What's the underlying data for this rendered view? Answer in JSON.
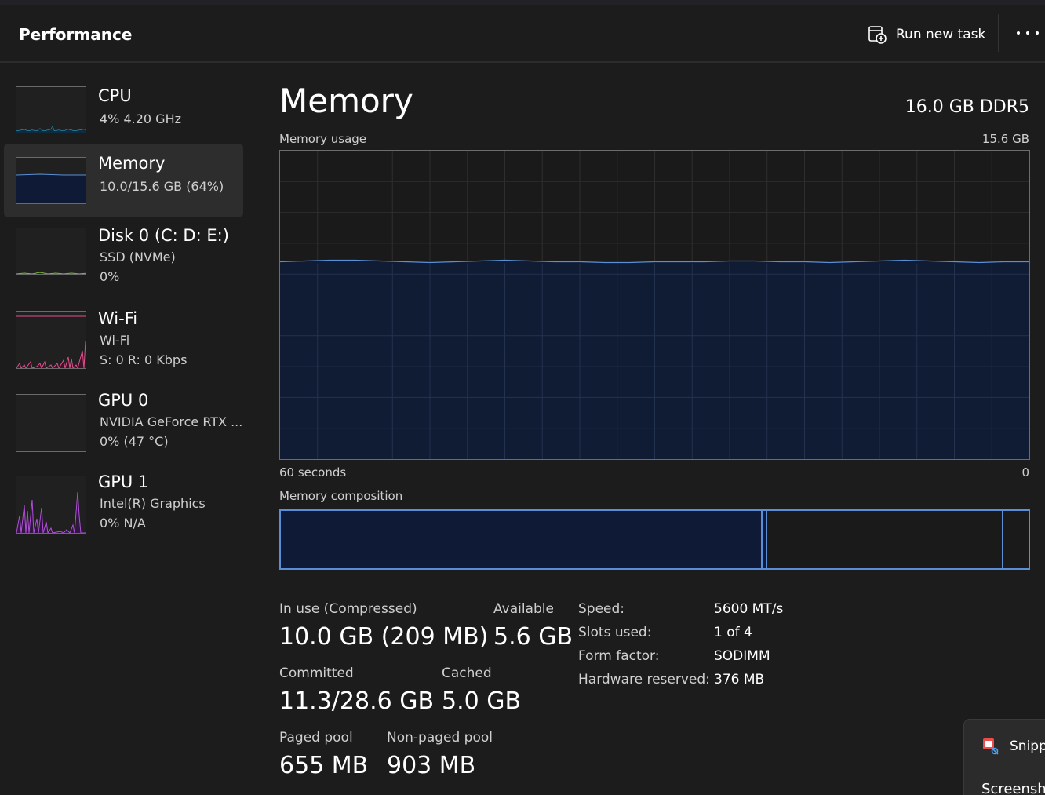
{
  "header": {
    "title": "Performance",
    "run_task_label": "Run new task",
    "more_icon": "more-options-icon"
  },
  "sidebar": {
    "items": [
      {
        "name": "CPU",
        "sub1": "4%  4.20 GHz",
        "sub2": "",
        "color": "#3ab4e8",
        "selected": false
      },
      {
        "name": "Memory",
        "sub1": "10.0/15.6 GB (64%)",
        "sub2": "",
        "color": "#5a8fd8",
        "selected": true
      },
      {
        "name": "Disk 0 (C: D: E:)",
        "sub1": "SSD (NVMe)",
        "sub2": "0%",
        "color": "#7fbf3f",
        "selected": false
      },
      {
        "name": "Wi-Fi",
        "sub1": "Wi-Fi",
        "sub2": "S: 0  R: 0 Kbps",
        "color": "#e0508c",
        "selected": false
      },
      {
        "name": "GPU 0",
        "sub1": "NVIDIA GeForce RTX ...",
        "sub2": "0%  (47 °C)",
        "color": "#b050d8",
        "selected": false
      },
      {
        "name": "GPU 1",
        "sub1": "Intel(R) Graphics",
        "sub2": "0%  N/A",
        "color": "#b050d8",
        "selected": false
      }
    ]
  },
  "memory": {
    "title": "Memory",
    "total_type": "16.0 GB DDR5",
    "usage_label": "Memory usage",
    "usage_max": "15.6 GB",
    "time_label": "60 seconds",
    "time_zero": "0",
    "usage_fraction": 0.64,
    "composition_label": "Memory composition",
    "composition": {
      "in_use_fraction": 0.64,
      "modified_fraction": 0.005,
      "standby_fraction": 0.32,
      "free_fraction": 0.035
    },
    "stats": {
      "in_use_label": "In use (Compressed)",
      "in_use_value": "10.0 GB (209 MB)",
      "available_label": "Available",
      "available_value": "5.6 GB",
      "committed_label": "Committed",
      "committed_value": "11.3/28.6 GB",
      "cached_label": "Cached",
      "cached_value": "5.0 GB",
      "paged_label": "Paged pool",
      "paged_value": "655 MB",
      "nonpaged_label": "Non-paged pool",
      "nonpaged_value": "903 MB"
    },
    "details": [
      {
        "label": "Speed:",
        "value": "5600 MT/s"
      },
      {
        "label": "Slots used:",
        "value": "1 of 4"
      },
      {
        "label": "Form factor:",
        "value": "SODIMM"
      },
      {
        "label": "Hardware reserved:",
        "value": "376 MB"
      }
    ],
    "accent_color": "#5a8fd8",
    "fill_color": "#0f1b36"
  },
  "flyout": {
    "line1": "Snipp",
    "line2": "Screensh"
  }
}
